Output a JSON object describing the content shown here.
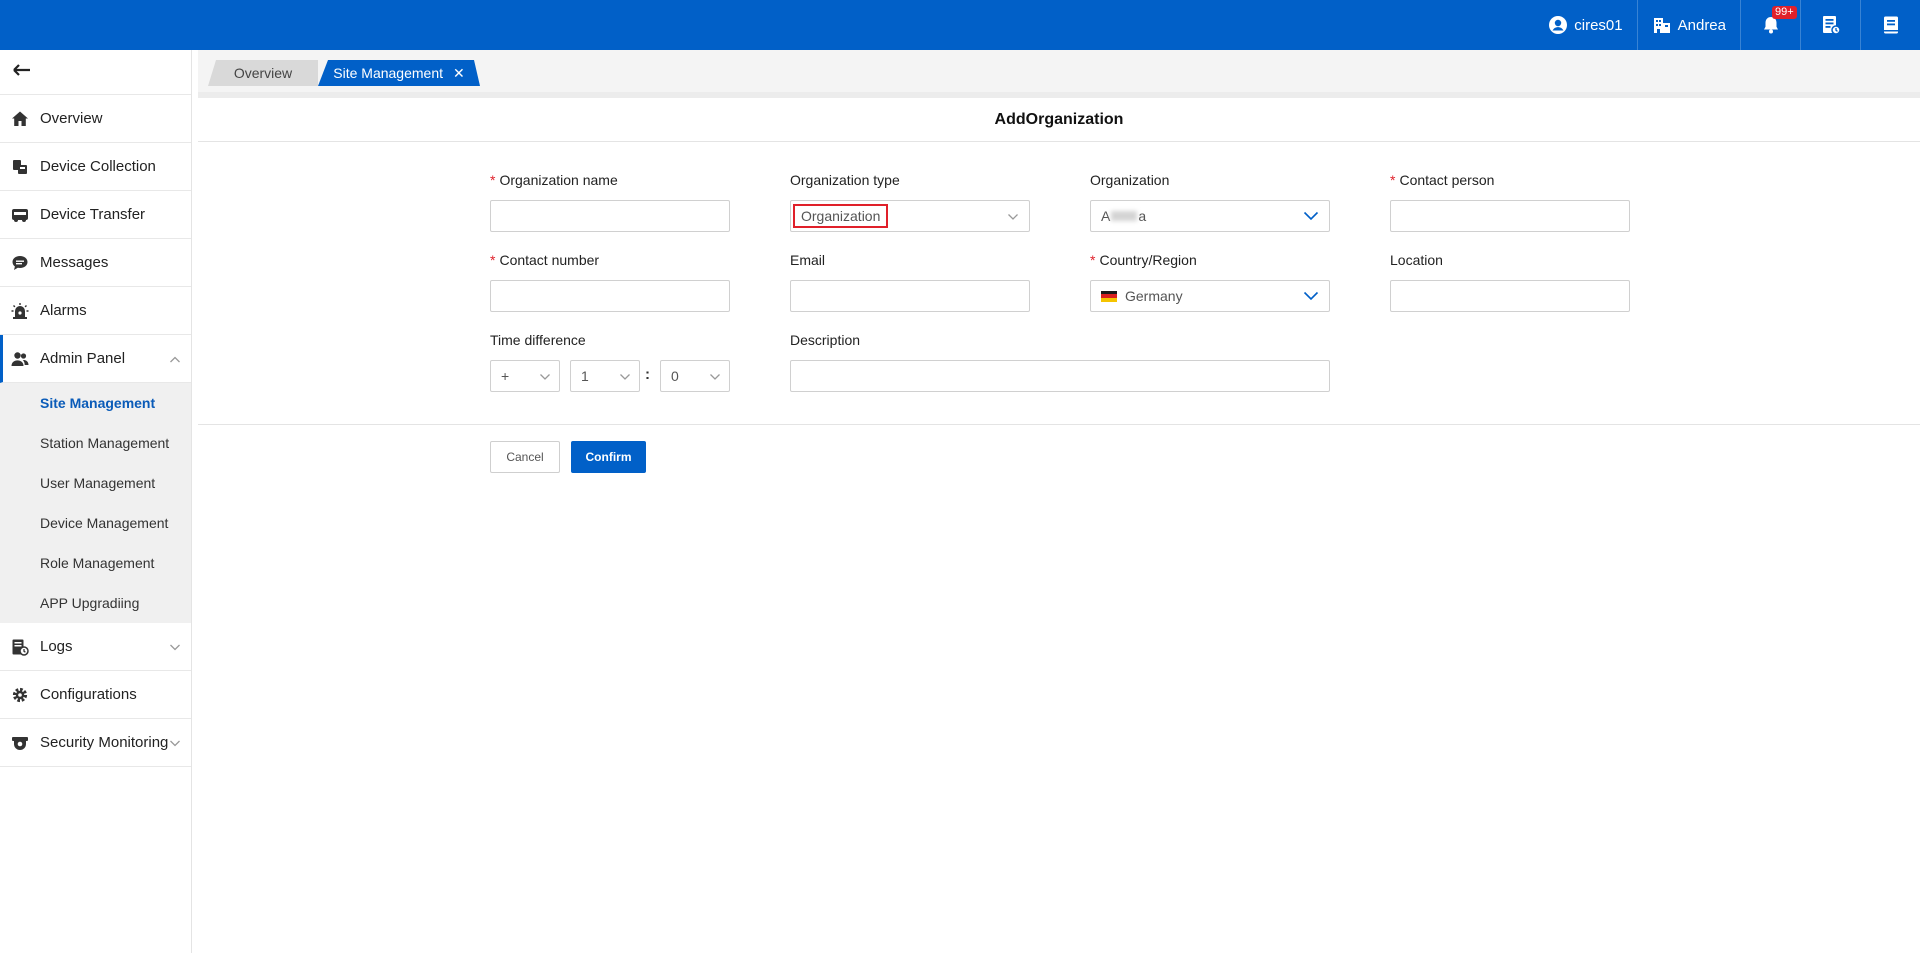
{
  "header": {
    "user": "cires01",
    "org": "Andrea",
    "notification_badge": "99+",
    "icons": [
      "user-circle-icon",
      "building-icon",
      "bell-icon",
      "report-icon",
      "book-icon"
    ],
    "brand_color": "#0160c8"
  },
  "sidebar": {
    "items": [
      {
        "label": "Overview",
        "icon": "home-icon"
      },
      {
        "label": "Device Collection",
        "icon": "device-collection-icon"
      },
      {
        "label": "Device Transfer",
        "icon": "truck-icon"
      },
      {
        "label": "Messages",
        "icon": "chat-icon"
      },
      {
        "label": "Alarms",
        "icon": "alarm-icon"
      },
      {
        "label": "Admin Panel",
        "icon": "users-icon"
      }
    ],
    "admin_sub": [
      {
        "label": "Site Management"
      },
      {
        "label": "Station Management"
      },
      {
        "label": "User Management"
      },
      {
        "label": "Device Management"
      },
      {
        "label": "Role Management"
      },
      {
        "label": "APP Upgradiing"
      }
    ],
    "bottom_items": [
      {
        "label": "Logs",
        "icon": "logs-icon"
      },
      {
        "label": "Configurations",
        "icon": "gear-icon"
      },
      {
        "label": "Security Monitoring",
        "icon": "camera-icon"
      }
    ]
  },
  "tabs": [
    {
      "label": "Overview"
    },
    {
      "label": "Site Management"
    }
  ],
  "form": {
    "title": "AddOrganization",
    "org_name_label": "Organization name",
    "org_type_label": "Organization type",
    "org_type_value": "Organization",
    "organization_label": "Organization",
    "organization_value_start": "A",
    "organization_value_end": "a",
    "contact_person_label": "Contact person",
    "contact_number_label": "Contact number",
    "email_label": "Email",
    "country_label": "Country/Region",
    "country_value": "Germany",
    "location_label": "Location",
    "time_diff_label": "Time difference",
    "time_sign": "+",
    "time_hours": "1",
    "time_sep": ":",
    "time_minutes": "0",
    "description_label": "Description",
    "required_mark": "*"
  },
  "buttons": {
    "cancel": "Cancel",
    "confirm": "Confirm"
  }
}
